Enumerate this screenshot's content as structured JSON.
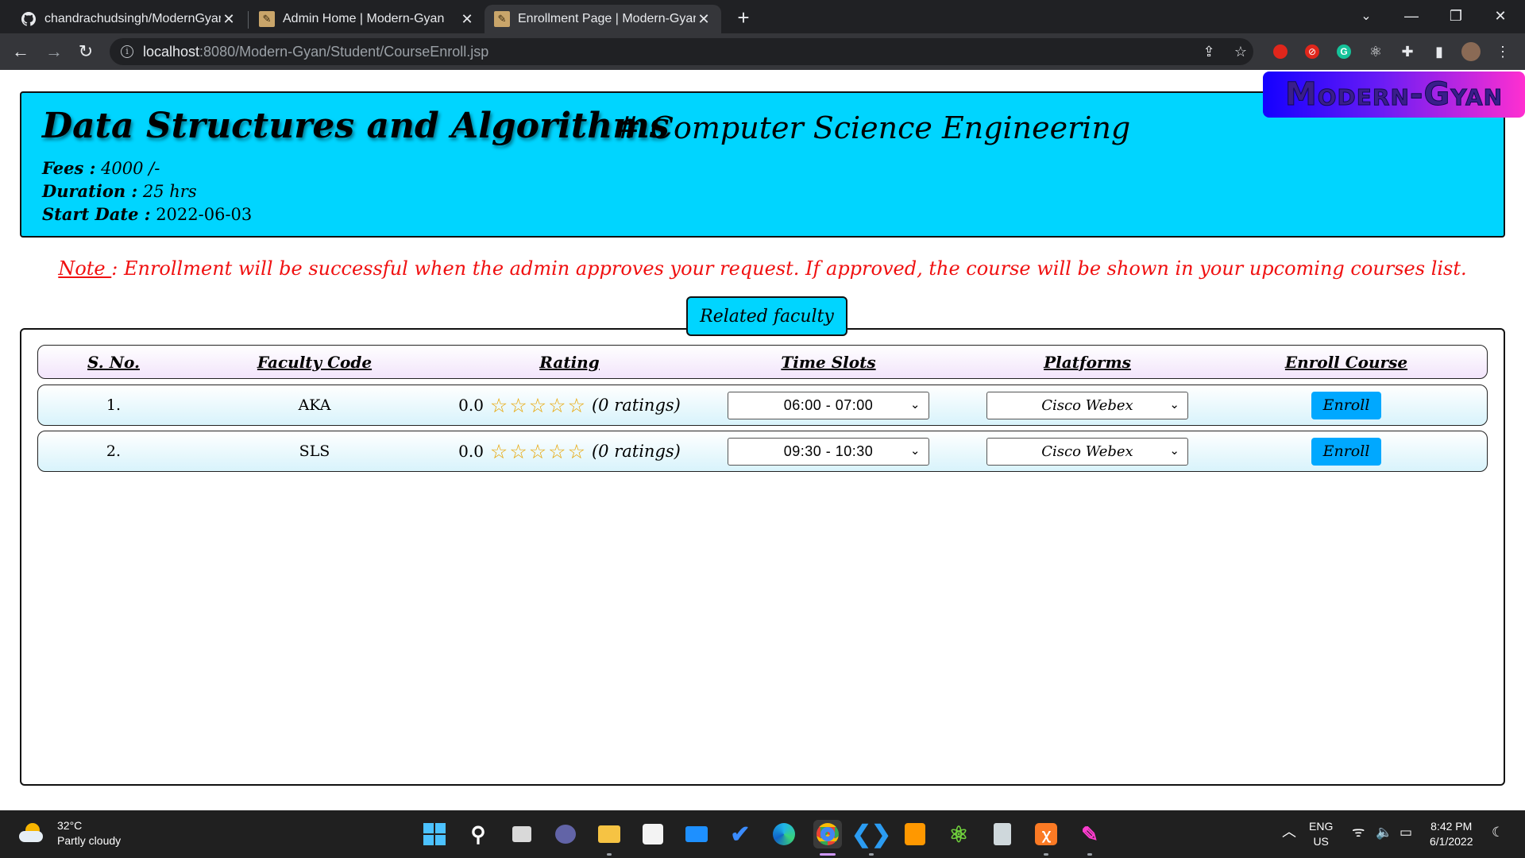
{
  "browser": {
    "tabs": [
      {
        "title": "chandrachudsingh/ModernGyan",
        "close": "✕"
      },
      {
        "title": "Admin Home | Modern-Gyan",
        "close": "✕"
      },
      {
        "title": "Enrollment Page | Modern-Gyan",
        "close": "✕",
        "active": true
      }
    ],
    "new_tab": "+",
    "url_host": "localhost",
    "url_path": ":8080/Modern-Gyan/Student/CourseEnroll.jsp"
  },
  "logo": {
    "text": "Modern-Gyan"
  },
  "course": {
    "title": "Data Structures and Algorithms",
    "branch": "# Computer Science Engineering",
    "fees_label": "Fees :",
    "fees_value": "4000 /-",
    "duration_label": "Duration :",
    "duration_value": "25 hrs",
    "start_label": "Start Date :",
    "start_value": "2022-06-03"
  },
  "note": {
    "label": "Note ",
    "text": ": Enrollment will be successful when the admin approves your request. If approved, the course will be shown in your upcoming courses list."
  },
  "faculty": {
    "section_button": "Related faculty",
    "columns": [
      "S. No.",
      "Faculty Code",
      "Rating",
      "Time Slots",
      "Platforms",
      "Enroll Course"
    ],
    "rows": [
      {
        "sno": "1.",
        "code": "AKA",
        "rating": "0.0",
        "stars": "☆☆☆☆☆",
        "ratings_count": "(0 ratings)",
        "time_slot": "06:00 - 07:00",
        "platform": "Cisco Webex",
        "enroll": "Enroll"
      },
      {
        "sno": "2.",
        "code": "SLS",
        "rating": "0.0",
        "stars": "☆☆☆☆☆",
        "ratings_count": "(0 ratings)",
        "time_slot": "09:30 - 10:30",
        "platform": "Cisco Webex",
        "enroll": "Enroll"
      }
    ]
  },
  "taskbar": {
    "temperature": "32°C",
    "weather": "Partly cloudy",
    "lang_top": "ENG",
    "lang_bottom": "US",
    "time": "8:42 PM",
    "date": "6/1/2022"
  },
  "colors": {
    "header_bg": "#00d5ff",
    "note_red": "#f01010",
    "enroll_blue": "#00a8ff",
    "star_orange": "#e8a400"
  }
}
